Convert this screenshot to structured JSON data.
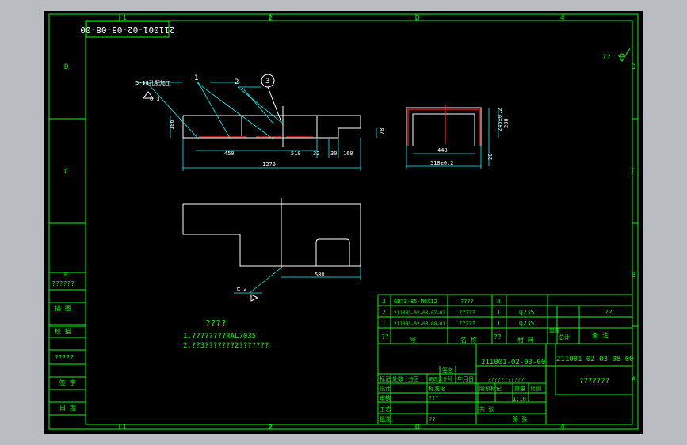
{
  "drawing": {
    "code_box": "211001-02-03-08-00",
    "top_right_mark": "??",
    "zone_cols": [
      "1",
      "2",
      "3",
      "4"
    ],
    "zone_rows": [
      "D",
      "C",
      "B",
      "A"
    ],
    "left_bar": {
      "label_top": "??????",
      "label_1": "描 图",
      "label_2": "校 描",
      "label_3": "?????",
      "label_4": "签 字",
      "label_5": "日 期"
    },
    "view1": {
      "note": "5-Φ8孔配加工",
      "surface": "6.3",
      "balloons": [
        "1",
        "2",
        "3"
      ],
      "dims": {
        "h186": "186",
        "d450": "450",
        "d510": "510",
        "d32": "32",
        "d30": "30",
        "d160": "160",
        "d1270": "1270",
        "d78": "78"
      }
    },
    "view2": {
      "dims": {
        "d448": "448",
        "d518": "518±0.2",
        "d245": "245±0.2",
        "d200": "200",
        "d20": "20"
      }
    },
    "view3": {
      "dim580": "580",
      "weld_symbol": "⊏ 2"
    },
    "notes": {
      "title": "????",
      "line1": "1.????????RAL7035",
      "line2": "2.??3???????2???????"
    },
    "bom": {
      "rows": [
        {
          "no": "3",
          "code": "GB73-85-M8X12",
          "name": "????",
          "qty": "4",
          "material": "",
          "remark": ""
        },
        {
          "no": "2",
          "code": "211001-02-03-07-02",
          "name": "?????",
          "qty": "1",
          "material": "Q235",
          "remark": "??"
        },
        {
          "no": "1",
          "code": "211001-02-03-08-01",
          "name": "?????",
          "qty": "1",
          "material": "Q235",
          "remark": ""
        }
      ],
      "header": {
        "no": "??",
        "code": "号",
        "name": "名 称",
        "qty": "??",
        "material": "材 料",
        "unit_weight": "单重",
        "total_weight": "总计",
        "remark": "备 注"
      }
    },
    "title_block": {
      "assembly_code": "211001-02-03-00",
      "drawing_code": "211001-02-03-08-00",
      "part_name": "???????",
      "material_note": "???????????",
      "scale": "1:10",
      "labels": {
        "mark": "标记",
        "count": "处数",
        "zone": "分区",
        "change_no": "更改文件号",
        "sign": "签名",
        "date": "年月日",
        "design": "设计",
        "check": "审核",
        "process": "工艺",
        "approve": "批准",
        "standard": "标准化",
        "stage": "阶段标记",
        "weight": "重量",
        "ratio": "比例",
        "sheets": "共 张",
        "sheet": "第 张",
        "std_qmark": "???",
        "designer_sig": "??"
      }
    },
    "colors": {
      "frame": "#00ff00",
      "geometry": "#ffffff",
      "dims": "#00ffff",
      "centerline": "#ff2020",
      "bg": "#000000",
      "chrome": "#b9bcc1"
    }
  }
}
